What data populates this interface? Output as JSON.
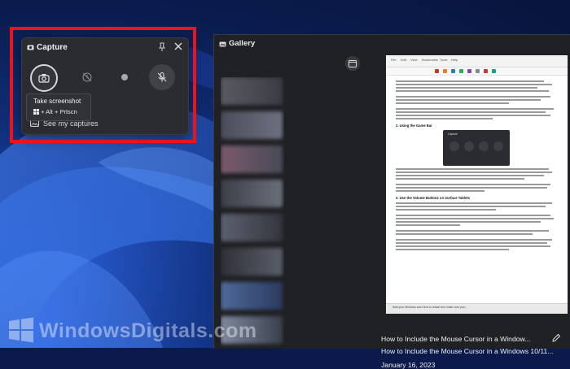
{
  "capture_widget": {
    "title": "Capture",
    "see_captures_label": "See my captures",
    "tooltip": {
      "title": "Take screenshot",
      "shortcut": "+ Alt + Prtscn"
    }
  },
  "gallery": {
    "title": "Gallery",
    "caption_line1": "How to Include the Mouse Cursor in a Window...",
    "caption_line2": "How to Include the Mouse Cursor in a Windows 10/11...",
    "date": "January 16, 2023"
  },
  "document": {
    "tabs": [
      "File",
      "Edit",
      "View",
      "Bookmarks",
      "Tools",
      "Help"
    ],
    "headings": [
      "2. Using the Game Bar",
      "3. Use the Volume Buttons on Surface Tablets"
    ],
    "mini_widget_title": "Capture",
    "footer": "Wait your Windows and Xbox to restart and make sure your..."
  },
  "watermark": {
    "text": "WindowsDigitals.com"
  },
  "colors": {
    "highlight": "#e8151f",
    "panel": "#2a2c31",
    "gallery_bg": "#202124"
  }
}
